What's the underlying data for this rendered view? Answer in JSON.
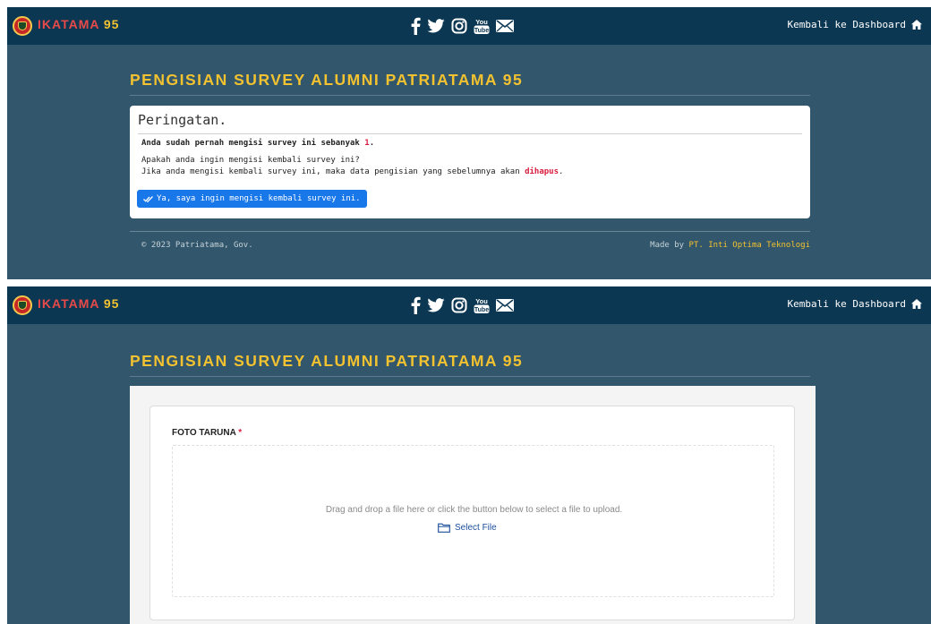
{
  "header": {
    "brand_name": "IKATAMA",
    "brand_number": "95",
    "social_icons": [
      "facebook-icon",
      "twitter-icon",
      "instagram-icon",
      "youtube-icon",
      "mail-icon"
    ],
    "dashboard_link": "Kembali ke Dashboard"
  },
  "page_title": "PENGISIAN SURVEY ALUMNI PATRIATAMA 95",
  "warning": {
    "title": "Peringatan.",
    "bold_prefix": "Anda sudah pernah mengisi survey ini sebanyak",
    "count": "1",
    "bold_suffix": ".",
    "question": "Apakah anda ingin mengisi kembali survey ini?",
    "note_prefix": "Jika anda mengisi kembali survey ini, maka data pengisian yang sebelumnya akan",
    "note_emphasis": "dihapus",
    "note_suffix": ".",
    "button_label": "Ya, saya ingin mengisi kembali survey ini."
  },
  "footer": {
    "copyright": "© 2023 Patriatama, Gov.",
    "made_by_label": "Made by",
    "made_by_company": "PT. Inti Optima Teknologi"
  },
  "upload_form": {
    "field_label": "FOTO TARUNA",
    "required_mark": "*",
    "dropzone_text": "Drag and drop a file here or click the button below to select a file to upload.",
    "select_button": "Select File"
  },
  "colors": {
    "topbar": "#0c3752",
    "background": "#32566b",
    "accent_yellow": "#f2c230",
    "brand_red": "#e84a4a",
    "button_blue": "#1877e9",
    "danger_red": "#d81b3c"
  }
}
